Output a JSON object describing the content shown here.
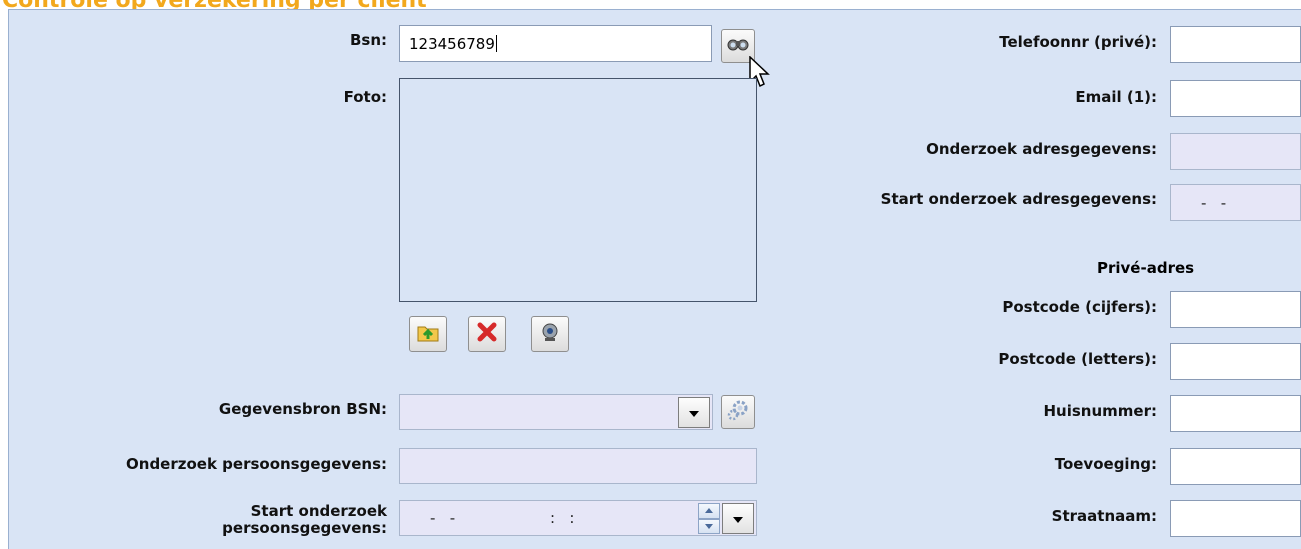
{
  "page": {
    "title": "Controle op verzekering per client"
  },
  "left": {
    "bsn": {
      "label": "Bsn:",
      "value": "123456789"
    },
    "foto": {
      "label": "Foto:"
    },
    "gegevensbron": {
      "label": "Gegevensbron BSN:",
      "value": ""
    },
    "onderzoek_persoon": {
      "label": "Onderzoek persoonsgegevens:",
      "value": ""
    },
    "start_onderzoek_persoon": {
      "label": "Start onderzoek persoonsgegevens:",
      "mask_date": "-   -",
      "mask_time": ":   :"
    }
  },
  "right": {
    "telefoon": {
      "label": "Telefoonnr (privé):",
      "value": ""
    },
    "email": {
      "label": "Email (1):",
      "value": ""
    },
    "onderzoek_adres": {
      "label": "Onderzoek adresgegevens:",
      "value": ""
    },
    "start_onderzoek_adres": {
      "label": "Start onderzoek adresgegevens:",
      "mask_date": "-   -"
    },
    "prive_adres_heading": "Privé-adres",
    "postcode_cijfers": {
      "label": "Postcode (cijfers):",
      "value": ""
    },
    "postcode_letters": {
      "label": "Postcode (letters):",
      "value": ""
    },
    "huisnummer": {
      "label": "Huisnummer:",
      "value": ""
    },
    "toevoeging": {
      "label": "Toevoeging:",
      "value": ""
    },
    "straatnaam": {
      "label": "Straatnaam:",
      "value": ""
    }
  },
  "icons": {
    "lookup": "binoculars-icon",
    "upload": "folder-upload-icon",
    "delete": "red-x-icon",
    "webcam": "webcam-icon",
    "settings": "gear-icon",
    "dropdown": "chevron-down-icon"
  },
  "colors": {
    "title": "#f2a81d",
    "panel_bg": "#d9e4f5",
    "disabled_field": "#e6e6f7"
  }
}
